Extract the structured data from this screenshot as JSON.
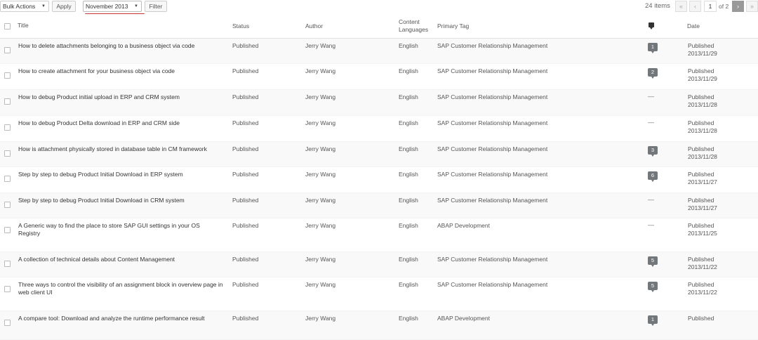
{
  "toolbar": {
    "bulk_actions": "Bulk Actions",
    "apply": "Apply",
    "date_filter": "November 2013",
    "filter": "Filter",
    "items_count": "24 items",
    "first": "«",
    "prev": "‹",
    "current_page": "1",
    "of_pages": "of 2",
    "next": "›",
    "last": "»"
  },
  "columns": {
    "title": "Title",
    "status": "Status",
    "author": "Author",
    "content_languages": "Content Languages",
    "primary_tag": "Primary Tag",
    "comments_icon": "comment-icon",
    "date": "Date"
  },
  "rows": [
    {
      "title": "How to delete attachments belonging to a business object via code",
      "status": "Published",
      "author": "Jerry Wang",
      "lang": "English",
      "tag": "SAP Customer Relationship Management",
      "comments": "1",
      "date_status": "Published",
      "date": "2013/11/29"
    },
    {
      "title": "How to create attachment for your business object via code",
      "status": "Published",
      "author": "Jerry Wang",
      "lang": "English",
      "tag": "SAP Customer Relationship Management",
      "comments": "2",
      "date_status": "Published",
      "date": "2013/11/29"
    },
    {
      "title": "How to debug Product initial upload in ERP and CRM system",
      "status": "Published",
      "author": "Jerry Wang",
      "lang": "English",
      "tag": "SAP Customer Relationship Management",
      "comments": "—",
      "date_status": "Published",
      "date": "2013/11/28"
    },
    {
      "title": "How to debug Product Delta download in ERP and CRM side",
      "status": "Published",
      "author": "Jerry Wang",
      "lang": "English",
      "tag": "SAP Customer Relationship Management",
      "comments": "—",
      "date_status": "Published",
      "date": "2013/11/28"
    },
    {
      "title": "How is attachment physically stored in database table in CM framework",
      "status": "Published",
      "author": "Jerry Wang",
      "lang": "English",
      "tag": "SAP Customer Relationship Management",
      "comments": "3",
      "date_status": "Published",
      "date": "2013/11/28"
    },
    {
      "title": "Step by step to debug Product Initial Download in ERP system",
      "status": "Published",
      "author": "Jerry Wang",
      "lang": "English",
      "tag": "SAP Customer Relationship Management",
      "comments": "6",
      "date_status": "Published",
      "date": "2013/11/27"
    },
    {
      "title": "Step by step to debug Product Initial Download in CRM system",
      "status": "Published",
      "author": "Jerry Wang",
      "lang": "English",
      "tag": "SAP Customer Relationship Management",
      "comments": "—",
      "date_status": "Published",
      "date": "2013/11/27"
    },
    {
      "title": "A Generic way to find the place to store SAP GUI settings in your OS Registry",
      "status": "Published",
      "author": "Jerry Wang",
      "lang": "English",
      "tag": "ABAP Development",
      "comments": "—",
      "date_status": "Published",
      "date": "2013/11/25"
    },
    {
      "title": "A collection of technical details about Content Management",
      "status": "Published",
      "author": "Jerry Wang",
      "lang": "English",
      "tag": "SAP Customer Relationship Management",
      "comments": "5",
      "date_status": "Published",
      "date": "2013/11/22"
    },
    {
      "title": "Three ways to control the visibility of an assignment block in overview page in web client UI",
      "status": "Published",
      "author": "Jerry Wang",
      "lang": "English",
      "tag": "SAP Customer Relationship Management",
      "comments": "5",
      "date_status": "Published",
      "date": "2013/11/22"
    },
    {
      "title": "A compare tool: Download and analyze the runtime performance result",
      "status": "Published",
      "author": "Jerry Wang",
      "lang": "English",
      "tag": "ABAP Development",
      "comments": "1",
      "date_status": "Published",
      "date": ""
    }
  ]
}
